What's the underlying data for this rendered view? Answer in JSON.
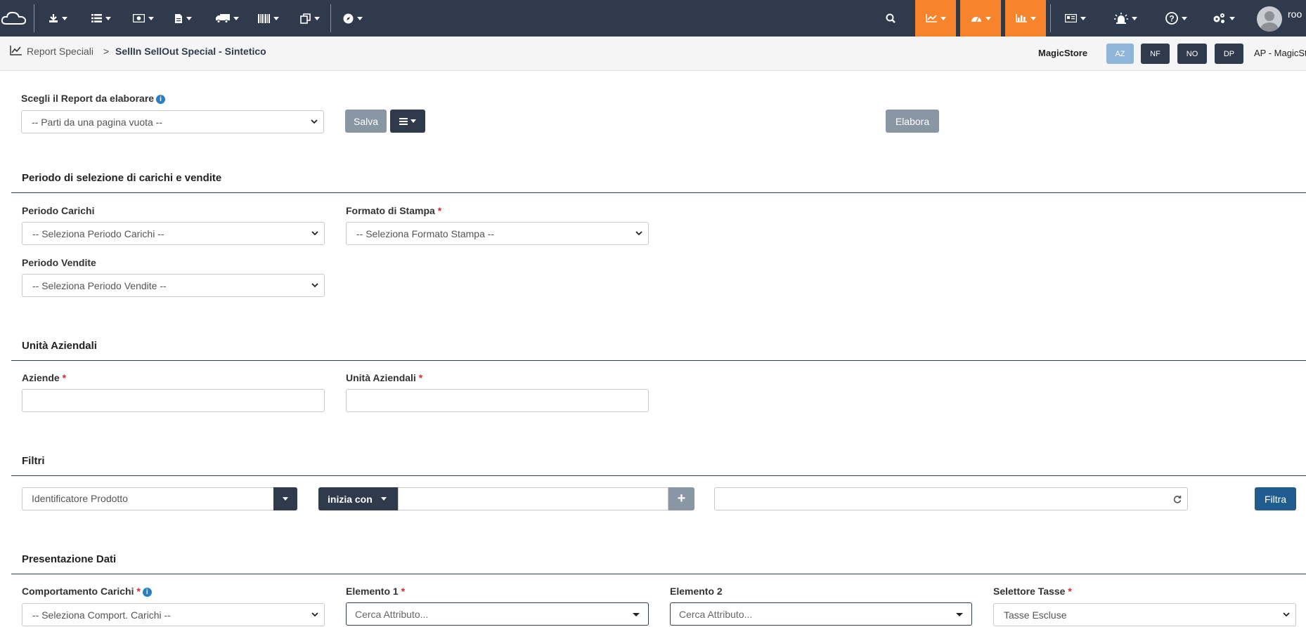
{
  "navbar": {
    "user_label": "roo",
    "icons": [
      "cloud-logo-icon",
      "download-icon",
      "list-icon",
      "money-icon",
      "document-icon",
      "truck-icon",
      "barcode-icon",
      "copy-icon",
      "compass-icon",
      "search-icon",
      "line-chart-icon",
      "dashboard-icon",
      "bar-chart-icon",
      "id-card-icon",
      "alarm-icon",
      "help-icon",
      "settings-icon",
      "user-avatar-icon"
    ],
    "accent": "#f7842a",
    "bg": "#2f3b4c"
  },
  "breadcrumb": {
    "parent": "Report Speciali",
    "separator": ">",
    "current": "SellIn SellOut Special - Sintetico"
  },
  "store": {
    "name": "MagicStore",
    "flags": [
      "AZ",
      "NF",
      "NO",
      "DP"
    ],
    "code": "AP - MagicSt"
  },
  "report": {
    "label": "Scegli il Report da elaborare",
    "select_value": "-- Parti da una pagina vuota --",
    "save_label": "Salva",
    "process_label": "Elabora"
  },
  "period_section": {
    "title": "Periodo di selezione di carichi e vendite",
    "carichi_label": "Periodo Carichi",
    "carichi_value": "-- Seleziona Periodo Carichi --",
    "formato_label": "Formato di Stampa",
    "formato_value": "-- Seleziona Formato Stampa --",
    "vendite_label": "Periodo Vendite",
    "vendite_value": "-- Seleziona Periodo Vendite --"
  },
  "units_section": {
    "title": "Unità Aziendali",
    "aziende_label": "Aziende",
    "unita_label": "Unità Aziendali",
    "required_mark": "*"
  },
  "filters_section": {
    "title": "Filtri",
    "field_value": "Identificatore Prodotto",
    "operator": "inizia con",
    "plus": "+",
    "filter_button": "Filtra"
  },
  "presentation_section": {
    "title": "Presentazione Dati",
    "comportamento_label": "Comportamento Carichi",
    "comportamento_value": "-- Seleziona Comport. Carichi --",
    "elemento1_label": "Elemento 1",
    "elemento1_placeholder": "Cerca Attributo...",
    "elemento2_label": "Elemento 2",
    "elemento2_placeholder": "Cerca Attributo...",
    "tasse_label": "Selettore Tasse",
    "tasse_value": "Tasse Escluse"
  }
}
